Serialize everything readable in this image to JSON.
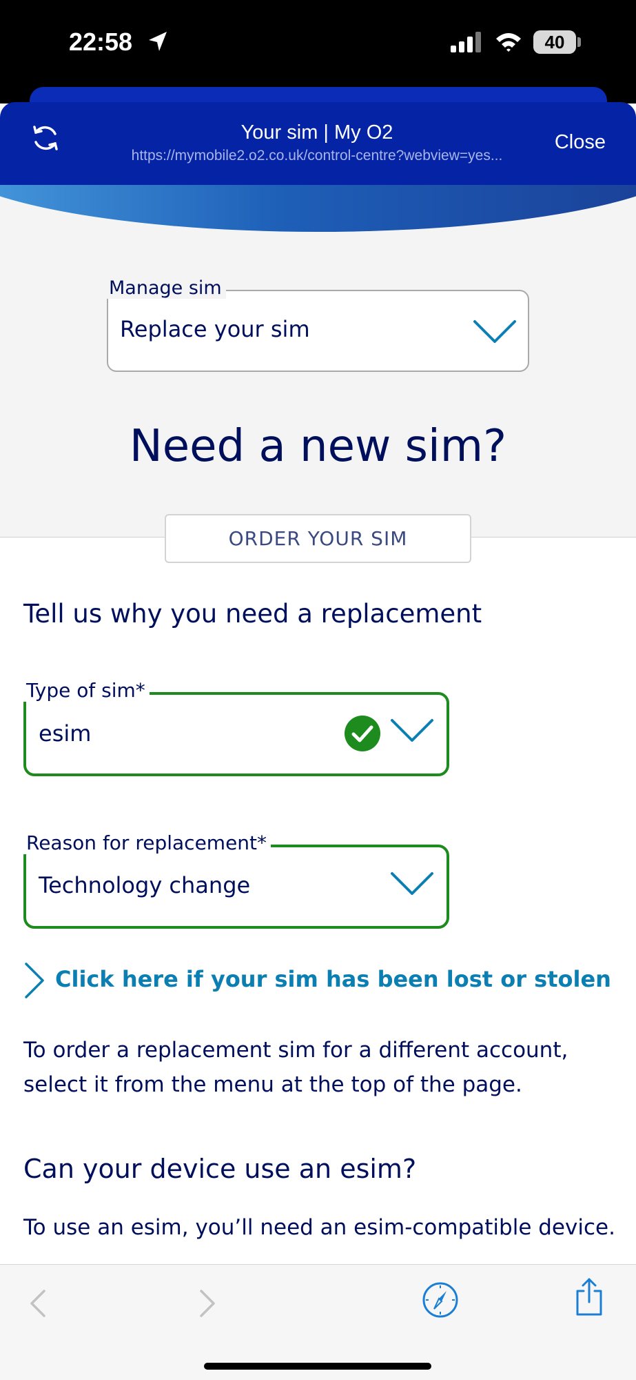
{
  "status_bar": {
    "time": "22:58",
    "battery": "40",
    "icons": [
      "location-arrow-icon",
      "signal-icon",
      "wifi-icon",
      "battery-icon"
    ]
  },
  "browser_header": {
    "title": "Your sim | My O2",
    "url": "https://mymobile2.o2.co.uk/control-centre?webview=yes...",
    "close_label": "Close",
    "reload_icon": "reload-icon"
  },
  "manage_sim": {
    "label": "Manage sim",
    "value": "Replace your sim"
  },
  "headline": "Need a new sim?",
  "order_button": "ORDER YOUR SIM",
  "section_heading": "Tell us why you need a replacement",
  "type_of_sim": {
    "label": "Type of sim*",
    "value": "esim",
    "status_color": "#1d8b1d"
  },
  "reason": {
    "label": "Reason for replacement*",
    "value": "Technology change"
  },
  "lost_link": "Click here if your sim has been lost or stolen",
  "paragraph_order": "To order a replacement sim for a different account, select it from the menu at the top of the page.",
  "esim_heading": "Can your device use an esim?",
  "paragraph_esim": "To use an esim, you’ll need an esim-compatible device.",
  "colors": {
    "brand_header": "#0423a5",
    "text_navy": "#000f5c",
    "link_blue": "#0b7fb2",
    "valid_green": "#1d8b1d"
  },
  "toolbar": {
    "icons": [
      "back-icon",
      "forward-icon",
      "compass-icon",
      "share-icon"
    ]
  }
}
